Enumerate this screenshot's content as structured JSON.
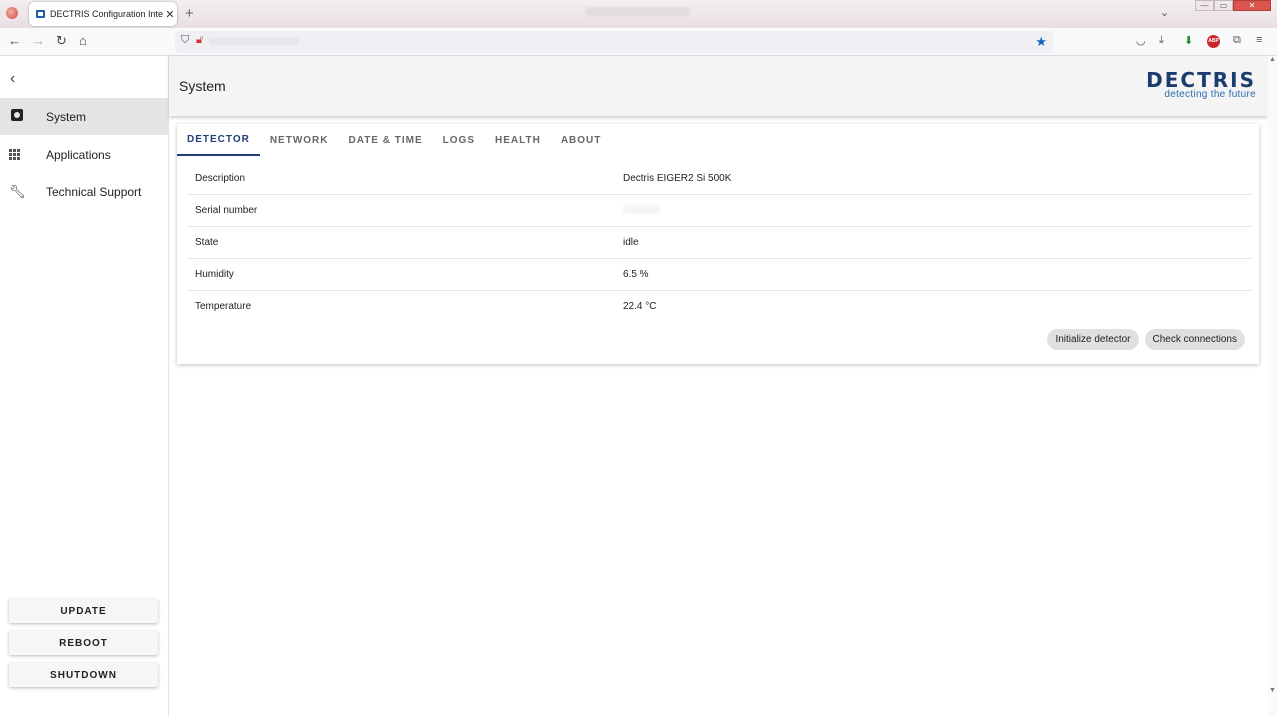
{
  "browser": {
    "tab_title": "DECTRIS Configuration Interfac",
    "tab_close": "✕",
    "new_tab": "+",
    "tab_list": "⌄",
    "win_min": "—",
    "win_max": "▭",
    "win_close": "✕"
  },
  "app": {
    "back": "‹",
    "header_title": "System",
    "logo_word": "DECTRIS",
    "logo_tagline": "detecting the future"
  },
  "sidebar": {
    "items": [
      {
        "label": "System",
        "icon": "gear-icon"
      },
      {
        "label": "Applications",
        "icon": "apps-grid-icon"
      },
      {
        "label": "Technical Support",
        "icon": "wrench-icon"
      }
    ],
    "actions": [
      "UPDATE",
      "REBOOT",
      "SHUTDOWN"
    ]
  },
  "tabs": [
    "DETECTOR",
    "NETWORK",
    "DATE & TIME",
    "LOGS",
    "HEALTH",
    "ABOUT"
  ],
  "detector": {
    "rows": [
      {
        "key": "Description",
        "value": "Dectris EIGER2 Si 500K"
      },
      {
        "key": "Serial number",
        "value": ""
      },
      {
        "key": "State",
        "value": "idle"
      },
      {
        "key": "Humidity",
        "value": "6.5 %"
      },
      {
        "key": "Temperature",
        "value": "22.4 °C"
      }
    ],
    "buttons": [
      "Initialize detector",
      "Check connections"
    ]
  },
  "colors": {
    "accent": "#1f3f7a",
    "logo": "#1b3c6e",
    "bookmark_star": "#1565c0"
  }
}
